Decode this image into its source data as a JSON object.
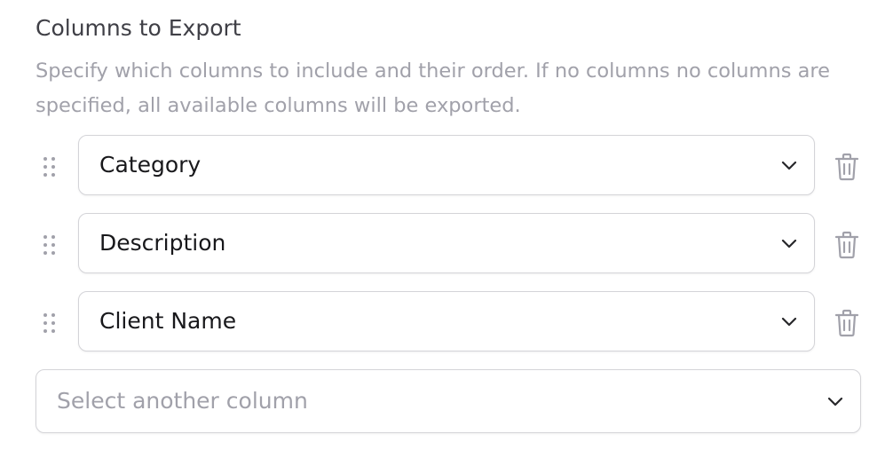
{
  "section": {
    "title": "Columns to Export",
    "description": "Specify which columns to include and their order. If no columns no columns are specified, all available columns will be exported."
  },
  "columns": [
    {
      "value": "Category"
    },
    {
      "value": "Description"
    },
    {
      "value": "Client Name"
    }
  ],
  "add_column": {
    "placeholder": "Select another column"
  },
  "icons": {
    "drag": "drag-handle-icon",
    "chevron": "chevron-down-icon",
    "delete": "trash-icon"
  },
  "colors": {
    "title": "#3f3f46",
    "muted_text": "#a1a1aa",
    "value_text": "#18181b",
    "border": "#d4d4d8",
    "icon": "#a1a1aa",
    "chevron": "#27272a"
  }
}
